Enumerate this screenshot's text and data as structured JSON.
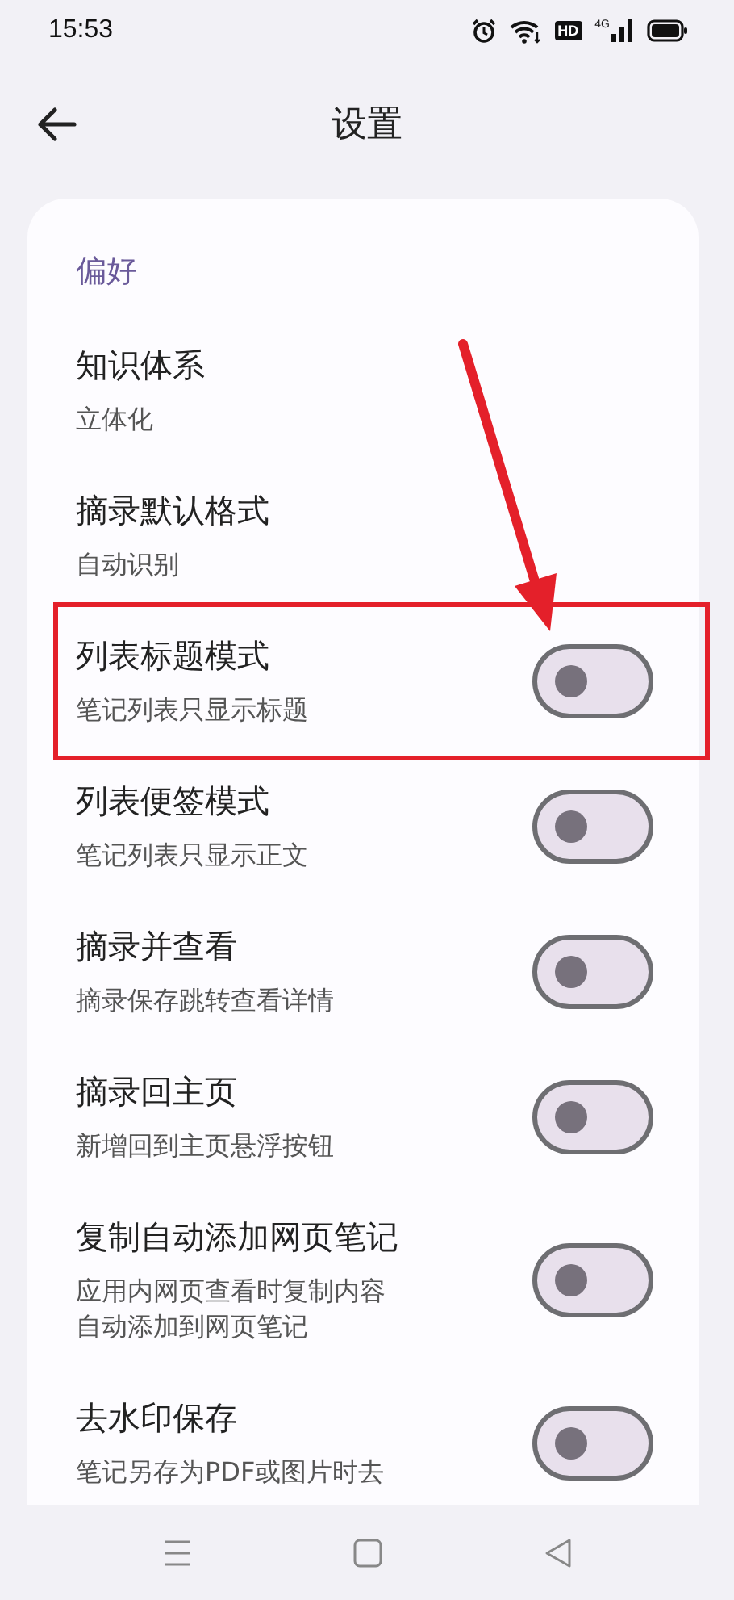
{
  "status_bar": {
    "time": "15:53",
    "hd_badge": "HD",
    "network": "4G"
  },
  "header": {
    "title": "设置"
  },
  "section": {
    "label": "偏好"
  },
  "items": [
    {
      "kind": "value",
      "title": "知识体系",
      "subtitle": "立体化",
      "highlighted": false
    },
    {
      "kind": "value",
      "title": "摘录默认格式",
      "subtitle": "自动识别",
      "highlighted": false
    },
    {
      "kind": "toggle",
      "title": "列表标题模式",
      "subtitle": "笔记列表只显示标题",
      "on": false,
      "highlighted": true
    },
    {
      "kind": "toggle",
      "title": "列表便签模式",
      "subtitle": "笔记列表只显示正文",
      "on": false,
      "highlighted": false
    },
    {
      "kind": "toggle",
      "title": "摘录并查看",
      "subtitle": "摘录保存跳转查看详情",
      "on": false,
      "highlighted": false
    },
    {
      "kind": "toggle",
      "title": "摘录回主页",
      "subtitle": "新增回到主页悬浮按钮",
      "on": false,
      "highlighted": false
    },
    {
      "kind": "toggle",
      "title": "复制自动添加网页笔记",
      "subtitle": "应用内网页查看时复制内容自动添加到网页笔记",
      "on": false,
      "highlighted": false
    },
    {
      "kind": "toggle",
      "title": "去水印保存",
      "subtitle": "笔记另存为PDF或图片时去",
      "on": false,
      "highlighted": false
    }
  ]
}
